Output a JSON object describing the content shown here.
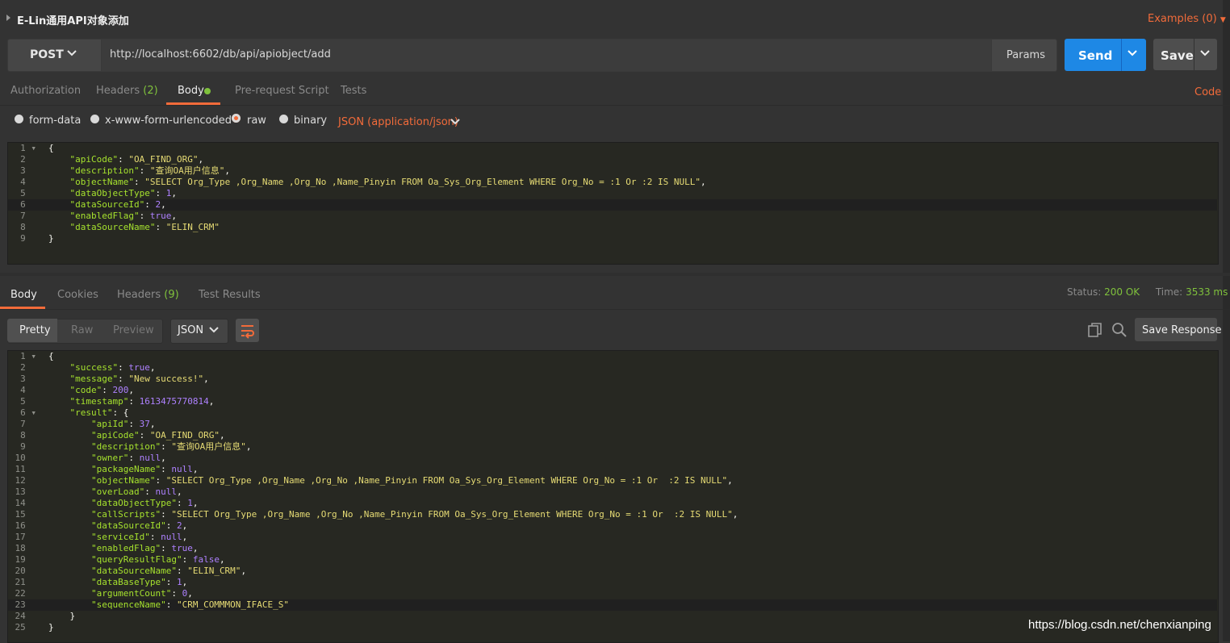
{
  "request": {
    "title": "E-Lin通用API对象添加",
    "examples_label": "Examples (0)",
    "method": "POST",
    "url": "http://localhost:6602/db/api/apiobject/add",
    "params_label": "Params",
    "send_label": "Send",
    "save_label": "Save",
    "tabs": [
      {
        "label": "Authorization"
      },
      {
        "label": "Headers",
        "count": "(2)"
      },
      {
        "label": "Body"
      },
      {
        "label": "Pre-request Script"
      },
      {
        "label": "Tests"
      }
    ],
    "code_link": "Code",
    "body_modes": [
      "form-data",
      "x-www-form-urlencoded",
      "raw",
      "binary"
    ],
    "selected_mode": "raw",
    "content_type": "JSON (application/json)",
    "body_lines": [
      "{",
      "    \"apiCode\": \"OA_FIND_ORG\",",
      "    \"description\": \"查询OA用户信息\",",
      "    \"objectName\": \"SELECT Org_Type ,Org_Name ,Org_No ,Name_Pinyin FROM Oa_Sys_Org_Element WHERE Org_No = :1 Or :2 IS NULL\",",
      "    \"dataObjectType\": 1,",
      "    \"dataSourceId\": 2,",
      "    \"enabledFlag\": true,",
      "    \"dataSourceName\": \"ELIN_CRM\"",
      "}"
    ]
  },
  "response": {
    "tabs": [
      {
        "label": "Body"
      },
      {
        "label": "Cookies"
      },
      {
        "label": "Headers",
        "count": "(9)"
      },
      {
        "label": "Test Results"
      }
    ],
    "status_label": "Status:",
    "status_value": "200 OK",
    "time_label": "Time:",
    "time_value": "3533 ms",
    "view_modes": [
      "Pretty",
      "Raw",
      "Preview"
    ],
    "format": "JSON",
    "save_response_label": "Save Response",
    "body_lines": [
      "{",
      "    \"success\": true,",
      "    \"message\": \"New success!\",",
      "    \"code\": 200,",
      "    \"timestamp\": 1613475770814,",
      "    \"result\": {",
      "        \"apiId\": 37,",
      "        \"apiCode\": \"OA_FIND_ORG\",",
      "        \"description\": \"查询OA用户信息\",",
      "        \"owner\": null,",
      "        \"packageName\": null,",
      "        \"objectName\": \"SELECT Org_Type ,Org_Name ,Org_No ,Name_Pinyin FROM Oa_Sys_Org_Element WHERE Org_No = :1 Or  :2 IS NULL\",",
      "        \"overLoad\": null,",
      "        \"dataObjectType\": 1,",
      "        \"callScripts\": \"SELECT Org_Type ,Org_Name ,Org_No ,Name_Pinyin FROM Oa_Sys_Org_Element WHERE Org_No = :1 Or  :2 IS NULL\",",
      "        \"dataSourceId\": 2,",
      "        \"serviceId\": null,",
      "        \"enabledFlag\": true,",
      "        \"queryResultFlag\": false,",
      "        \"dataSourceName\": \"ELIN_CRM\",",
      "        \"dataBaseType\": 1,",
      "        \"argumentCount\": 0,",
      "        \"sequenceName\": \"CRM_COMMMON_IFACE_S\"",
      "    }",
      "}"
    ]
  },
  "watermark": "https://blog.csdn.net/chenxianping",
  "colors": {
    "accent": "#f26b3a",
    "send": "#1e88e5",
    "ok": "#7fc13c",
    "background": "#333333"
  }
}
